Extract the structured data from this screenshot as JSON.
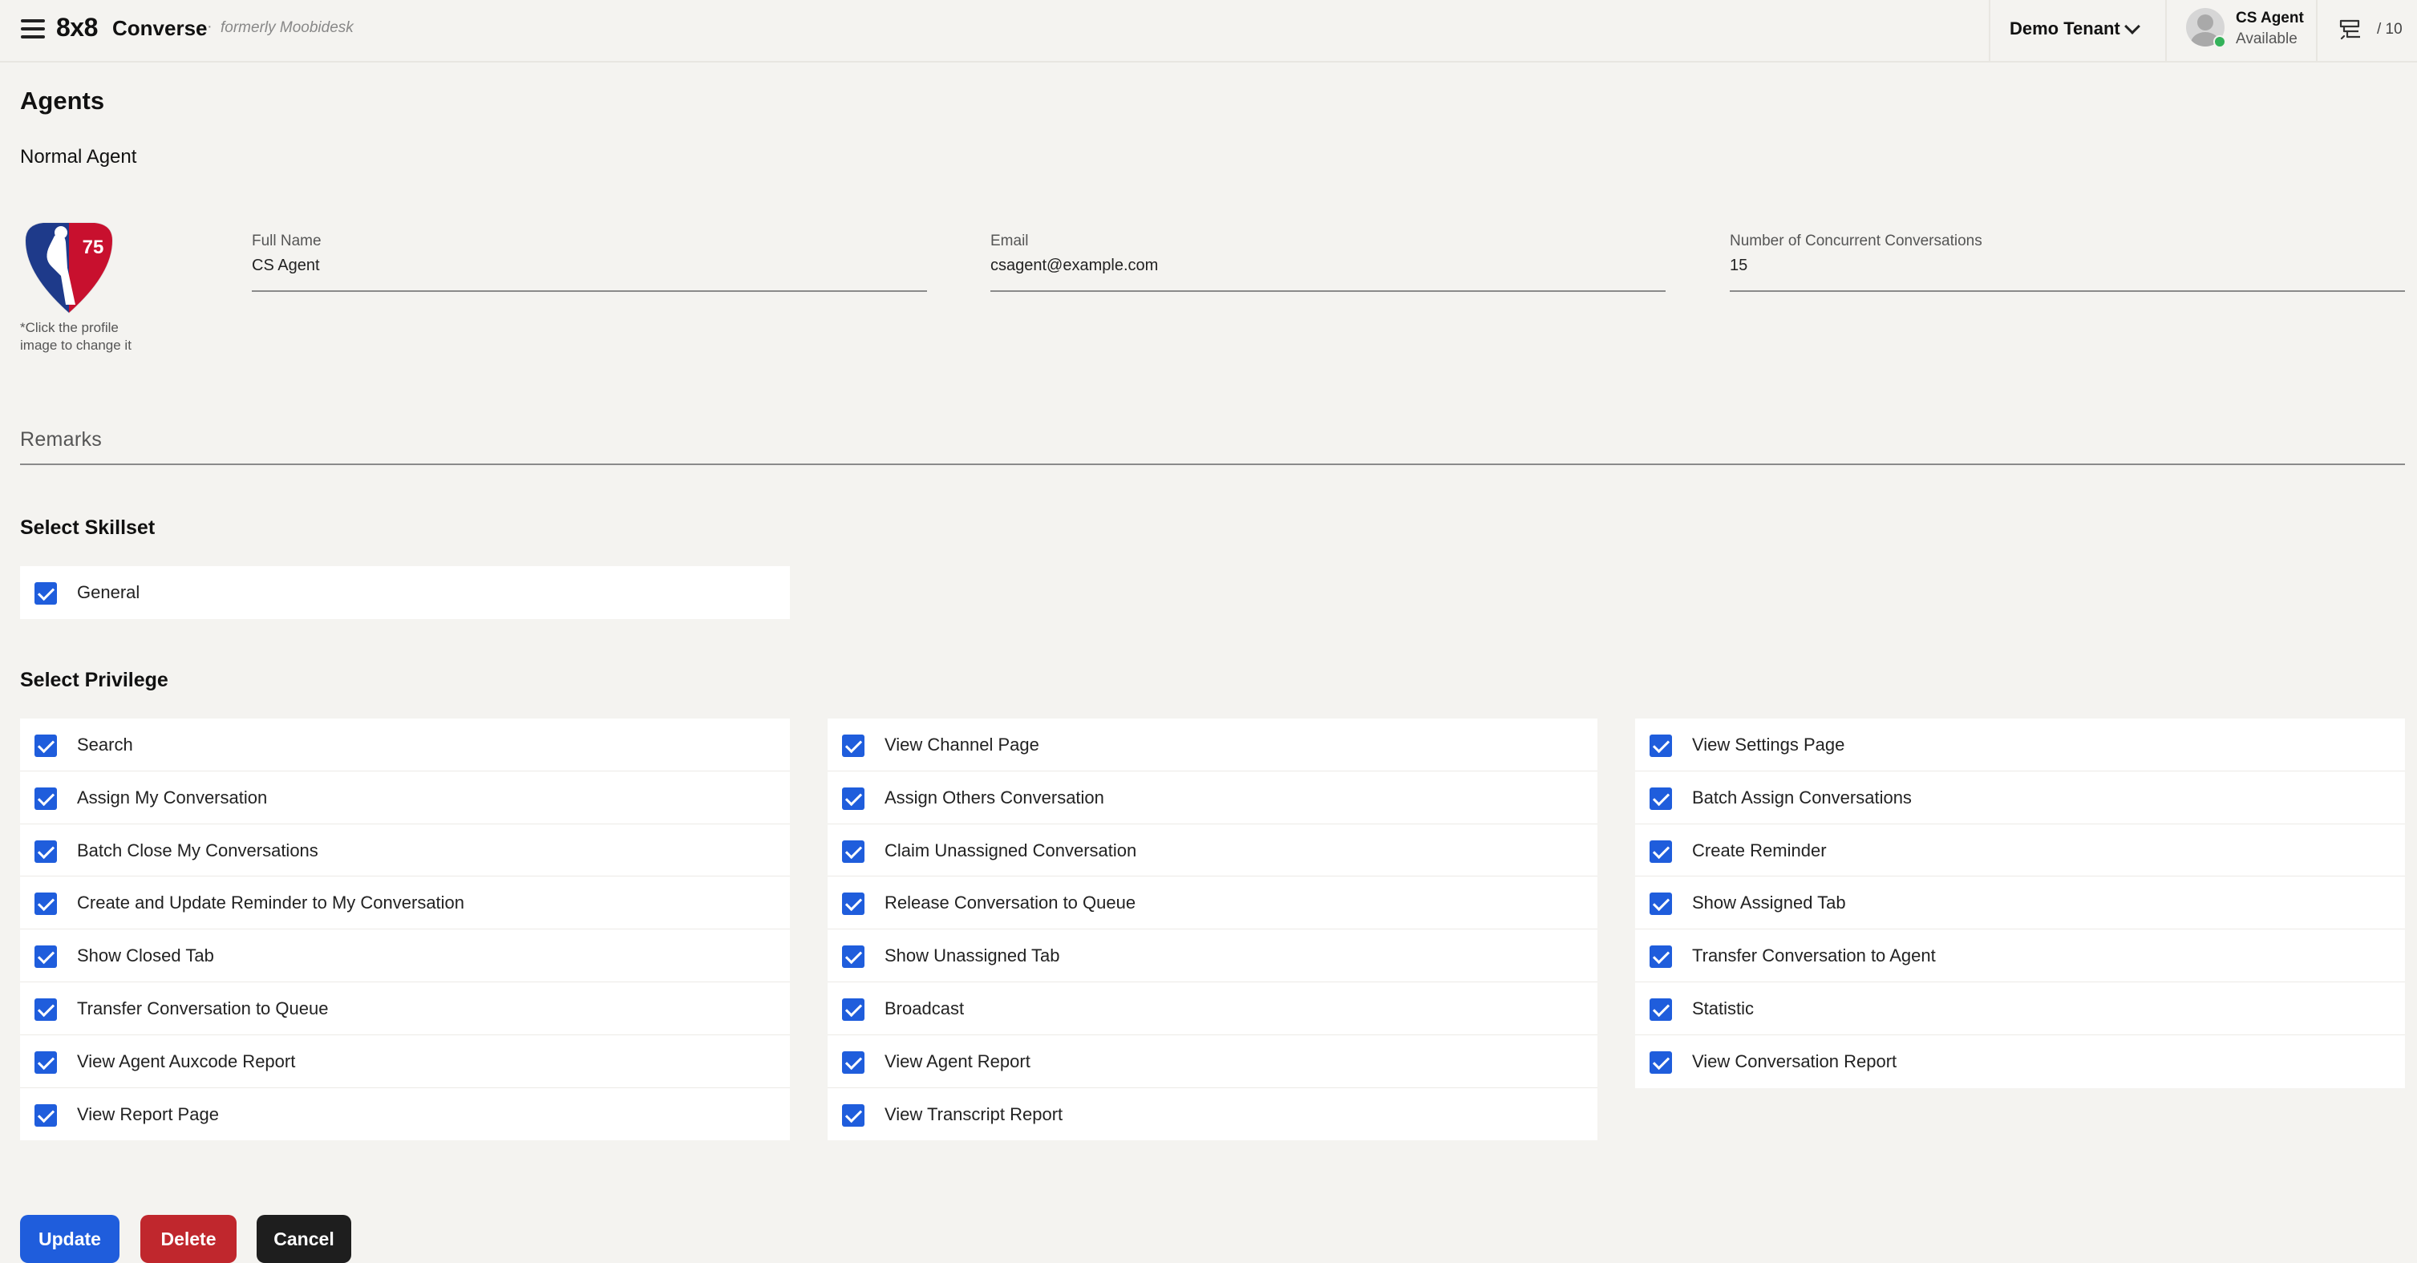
{
  "header": {
    "brand_logo": "8x8",
    "brand_name": "Converse",
    "separator": "·",
    "formerly": "formerly Moobidesk",
    "tenant": "Demo Tenant",
    "user_name": "CS Agent",
    "user_status": "Available",
    "queue_count": "/ 10"
  },
  "page": {
    "title": "Agents",
    "subtitle": "Normal Agent",
    "profile_hint": "*Click the profile image to change it"
  },
  "form": {
    "full_name": {
      "label": "Full Name",
      "value": "CS Agent"
    },
    "email": {
      "label": "Email",
      "value": "csagent@example.com"
    },
    "concurrent": {
      "label": "Number of Concurrent Conversations",
      "value": "15"
    },
    "remarks": {
      "label": "Remarks"
    }
  },
  "skillset": {
    "title": "Select Skillset",
    "items": [
      {
        "label": "General",
        "checked": true
      }
    ]
  },
  "privilege": {
    "title": "Select Privilege",
    "columns": [
      [
        {
          "label": "Search",
          "checked": true
        },
        {
          "label": "Assign My Conversation",
          "checked": true
        },
        {
          "label": "Batch Close My Conversations",
          "checked": true
        },
        {
          "label": "Create and Update Reminder to My Conversation",
          "checked": true
        },
        {
          "label": "Show Closed Tab",
          "checked": true
        },
        {
          "label": "Transfer Conversation to Queue",
          "checked": true
        },
        {
          "label": "View Agent Auxcode Report",
          "checked": true
        },
        {
          "label": "View Report Page",
          "checked": true
        }
      ],
      [
        {
          "label": "View Channel Page",
          "checked": true
        },
        {
          "label": "Assign Others Conversation",
          "checked": true
        },
        {
          "label": "Claim Unassigned Conversation",
          "checked": true
        },
        {
          "label": "Release Conversation to Queue",
          "checked": true
        },
        {
          "label": "Show Unassigned Tab",
          "checked": true
        },
        {
          "label": "Broadcast",
          "checked": true
        },
        {
          "label": "View Agent Report",
          "checked": true
        },
        {
          "label": "View Transcript Report",
          "checked": true
        }
      ],
      [
        {
          "label": "View Settings Page",
          "checked": true
        },
        {
          "label": "Batch Assign Conversations",
          "checked": true
        },
        {
          "label": "Create Reminder",
          "checked": true
        },
        {
          "label": "Show Assigned Tab",
          "checked": true
        },
        {
          "label": "Transfer Conversation to Agent",
          "checked": true
        },
        {
          "label": "Statistic",
          "checked": true
        },
        {
          "label": "View Conversation Report",
          "checked": true
        }
      ]
    ]
  },
  "actions": {
    "update": "Update",
    "delete": "Delete",
    "cancel": "Cancel"
  },
  "colors": {
    "primary": "#1f5ddc",
    "danger": "#c0272d",
    "dark": "#1e1e1e",
    "status_available": "#34b25a",
    "background": "#f4f3f0"
  }
}
